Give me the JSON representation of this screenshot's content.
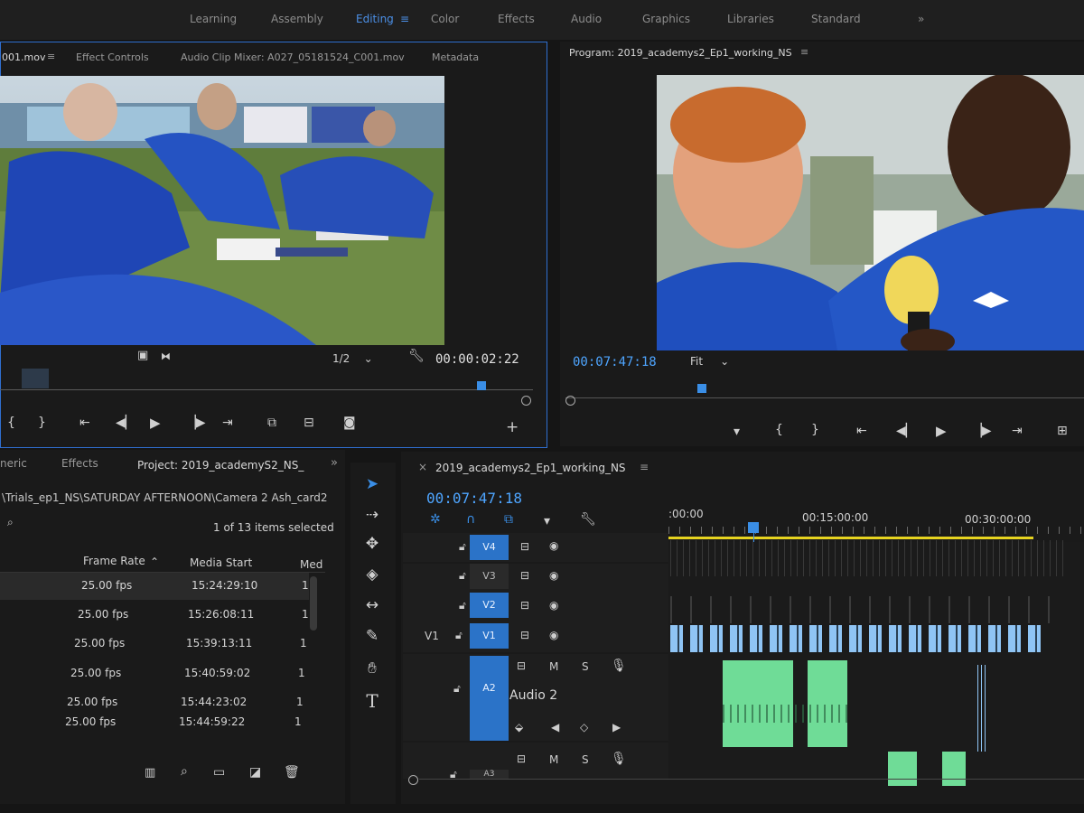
{
  "workspaces": [
    "Learning",
    "Assembly",
    "Editing",
    "Color",
    "Effects",
    "Audio",
    "Graphics",
    "Libraries",
    "Standard"
  ],
  "workspace_more": "»",
  "source_panel": {
    "tabs": [
      "001.mov",
      "Effect Controls",
      "Audio Clip Mixer: A027_05181524_C001.mov",
      "Metadata"
    ],
    "menu_icon": "≡",
    "resolution": "1/2",
    "timecode": "00:00:02:22"
  },
  "program_panel": {
    "title": "Program: 2019_academys2_Ep1_working_NS",
    "menu_icon": "≡",
    "timecode": "00:07:47:18",
    "fit": "Fit"
  },
  "project_panel": {
    "tabs": [
      "neric",
      "Effects",
      "Project: 2019_academyS2_NS_"
    ],
    "more": "»",
    "path": "\\Trials_ep1_NS\\SATURDAY AFTERNOON\\Camera 2 Ash_card2",
    "selection_info": "1 of 13 items selected",
    "columns": [
      "Frame Rate",
      "Media Start",
      "Med"
    ],
    "sort_icon": "⌃",
    "rows": [
      {
        "rate": "25.00 fps",
        "start": "15:24:29:10",
        "med": "1"
      },
      {
        "rate": "25.00 fps",
        "start": "15:26:08:11",
        "med": "1"
      },
      {
        "rate": "25.00 fps",
        "start": "15:39:13:11",
        "med": "1"
      },
      {
        "rate": "25.00 fps",
        "start": "15:40:59:02",
        "med": "1"
      },
      {
        "rate": "25.00 fps",
        "start": "15:44:23:02",
        "med": "1"
      },
      {
        "rate": "25.00 fps",
        "start": "15:44:59:22",
        "med": "1"
      }
    ]
  },
  "timeline": {
    "close": "×",
    "sequence_name": "2019_academys2_Ep1_working_NS",
    "menu_icon": "≡",
    "timecode": "00:07:47:18",
    "ruler": [
      ":00:00",
      "00:15:00:00",
      "00:30:00:00"
    ],
    "tracks": [
      {
        "id": "V4",
        "active": true
      },
      {
        "id": "V3",
        "active": false
      },
      {
        "id": "V2",
        "active": true
      },
      {
        "id": "V1",
        "active": true,
        "patch": "V1"
      },
      {
        "id": "A2",
        "active": true,
        "name": "Audio 2",
        "m": "M",
        "s": "S"
      },
      {
        "id": "A3",
        "active": false,
        "m": "M",
        "s": "S"
      }
    ]
  },
  "colors": {
    "accent": "#3a8ee6",
    "badge": "#2b73c8",
    "audio_clip": "#6fdc97",
    "video_clip": "#8fc4f4",
    "work_area": "#e6d320"
  }
}
